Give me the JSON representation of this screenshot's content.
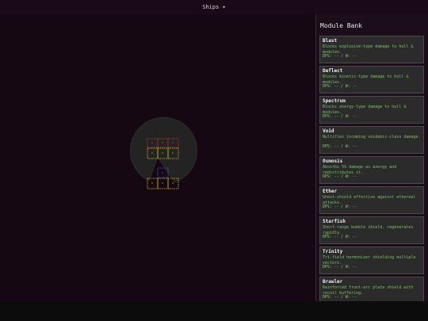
{
  "menu": {
    "ships_label": "Ships ▾"
  },
  "sidebar": {
    "title": "Module Bank",
    "modules": [
      {
        "name": "Blast",
        "desc": "Blocks explosive-type damage to hull & modules.",
        "stats": "DPS: -- / W: --"
      },
      {
        "name": "Deflect",
        "desc": "Blocks kinetic-type damage to hull & modules.",
        "stats": "DPS: -- / W: --"
      },
      {
        "name": "Spectrum",
        "desc": "Blocks energy-type damage to hull & modules.",
        "stats": "DPS: -- / W: --"
      },
      {
        "name": "Void",
        "desc": "Nullifies incoming voidemic-class damage.",
        "stats": "DPS: -- / W: --"
      },
      {
        "name": "Osmosis",
        "desc": "Absorbs 5% damage as energy and redistributes it.",
        "stats": "DPS: -- / W: --"
      },
      {
        "name": "Ether",
        "desc": "Ghost-shield effective against ethereal attacks.",
        "stats": "DPS: -- / W: --"
      },
      {
        "name": "Starfish",
        "desc": "Short-range bubble shield, regenerates rapidly.",
        "stats": "DPS: -- / W: --"
      },
      {
        "name": "Trinity",
        "desc": "Tri-field harmonizer shielding multiple vectors.",
        "stats": "DPS: -- / W: --"
      },
      {
        "name": "Brawler",
        "desc": "Reinforced front-arc plate shield with recoil buffering.",
        "stats": "DPS: -- / W: --"
      }
    ]
  },
  "colors": {
    "grid_red": "#d03030",
    "grid_yellow": "#e0c020",
    "grid_blue": "#3a70d0",
    "radar": "#2a2a2a"
  }
}
